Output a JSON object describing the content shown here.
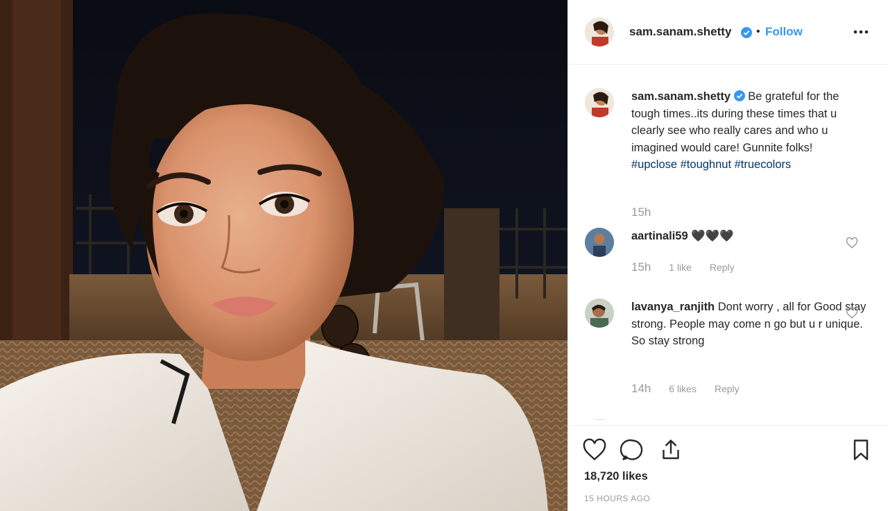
{
  "photo": {
    "alt_subject": "selfie photo"
  },
  "header": {
    "username": "sam.sanam.shetty",
    "separator": "•",
    "follow_label": "Follow"
  },
  "caption": {
    "username": "sam.sanam.shetty",
    "text": "Be grateful for the tough times..its during these times that u clearly see who really cares and who u imagined would care! Gunnite folks!",
    "hashtags": "#upclose #toughnut #truecolors",
    "time": "15h"
  },
  "comments": [
    {
      "username": "aartinali59",
      "text": "🖤🖤🖤",
      "time": "15h",
      "likes": "1 like",
      "reply_label": "Reply"
    },
    {
      "username": "lavanya_ranjith",
      "text": "Dont worry , all for Good stay strong. People may come n go but u r unique. So stay strong",
      "time": "14h",
      "likes": "6 likes",
      "reply_label": "Reply"
    }
  ],
  "actions": {
    "likes_count": "18,720 likes",
    "time_ago": "15 HOURS AGO"
  },
  "colors": {
    "link_blue": "#3897f0",
    "hashtag_blue": "#003569",
    "muted_gray": "#999999",
    "text_dark": "#262626"
  },
  "icons": [
    "verified-badge-icon",
    "more-options-icon",
    "heart-icon",
    "comment-icon",
    "share-icon",
    "bookmark-icon"
  ]
}
